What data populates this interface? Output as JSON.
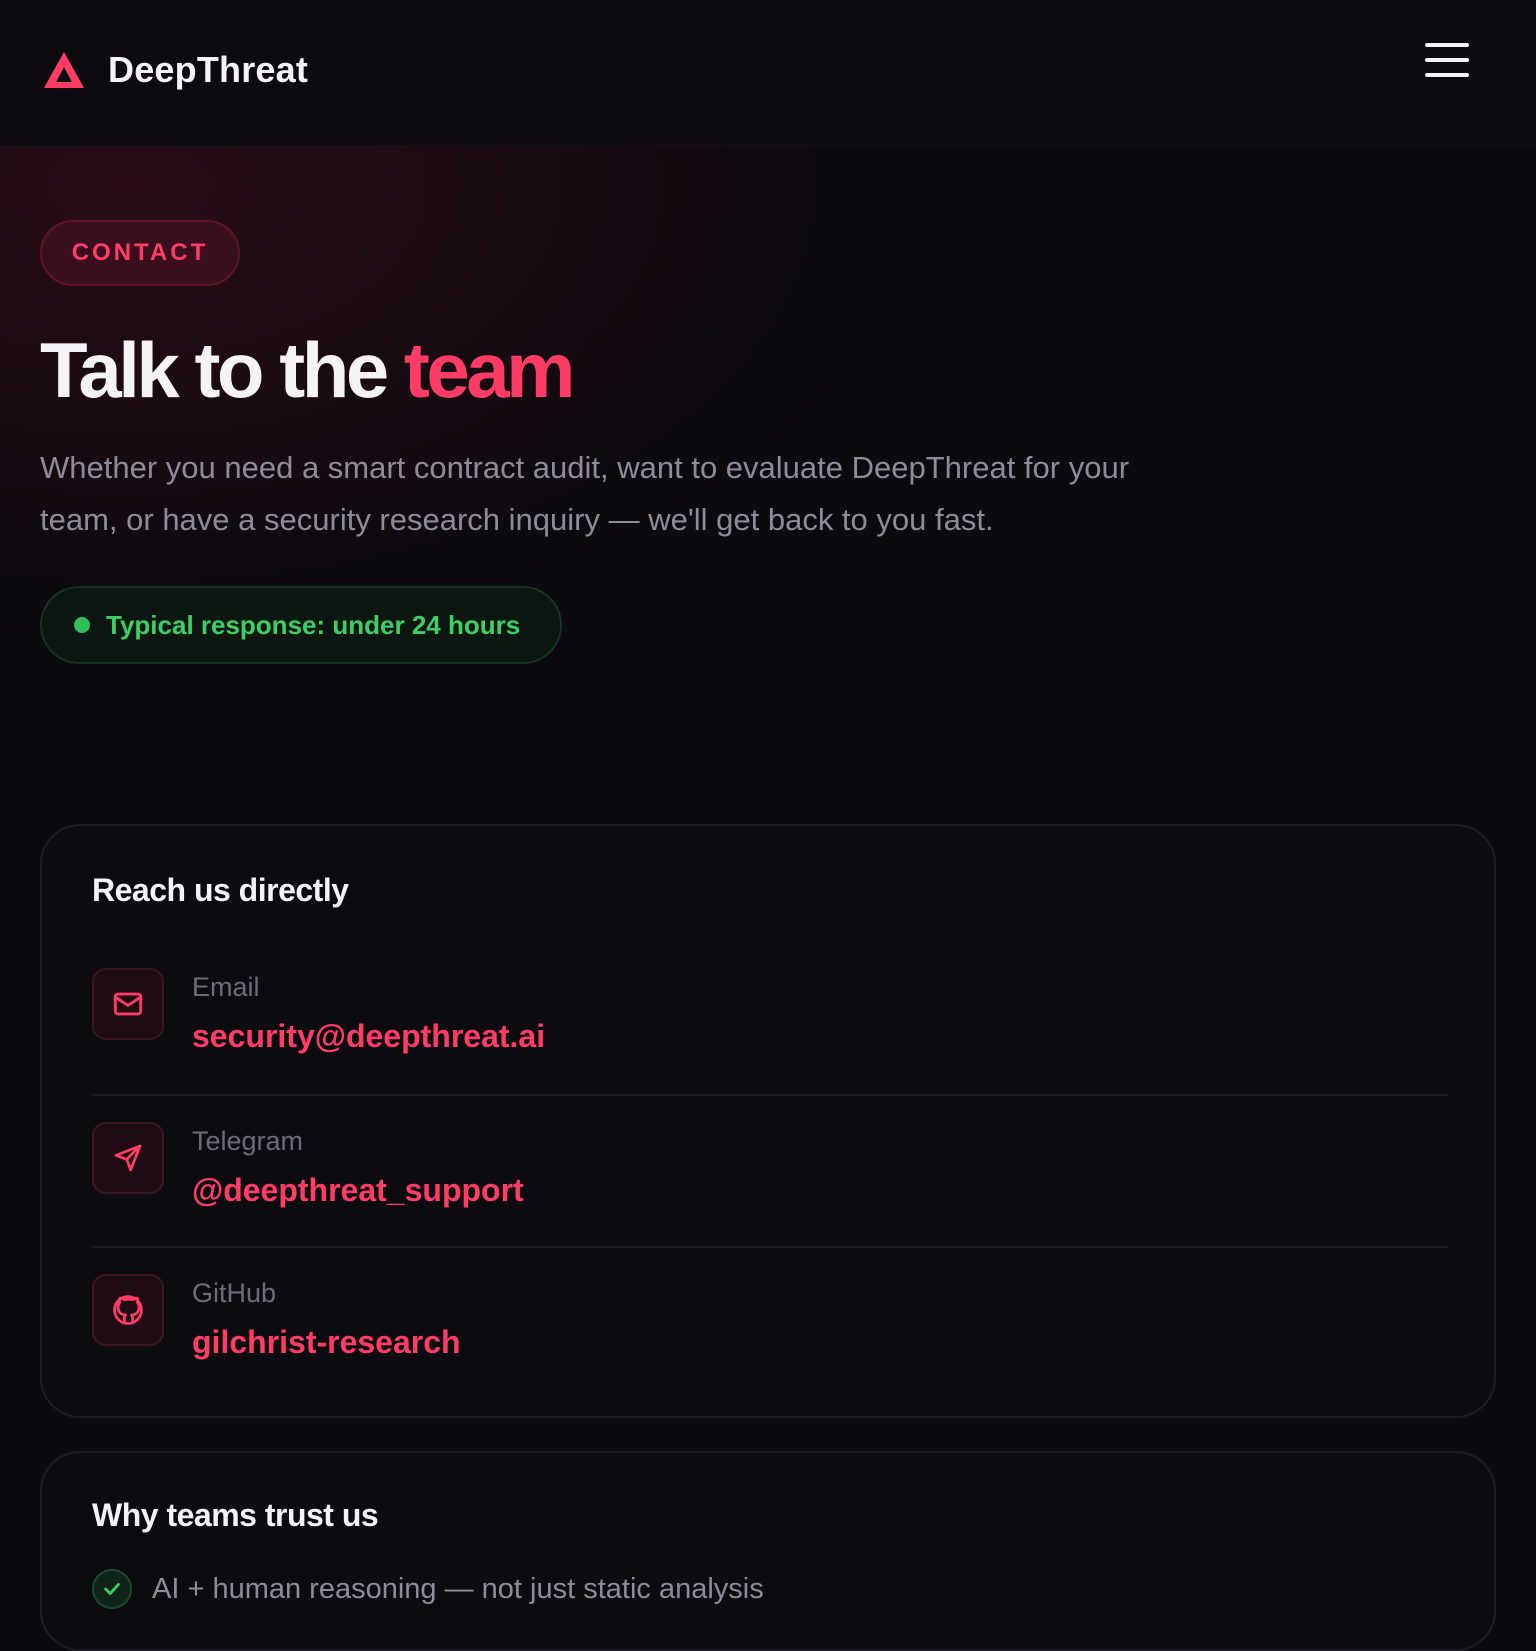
{
  "header": {
    "brand": "DeepThreat",
    "logo_icon": "triangle-logo-icon",
    "menu_icon": "hamburger-menu-icon"
  },
  "hero": {
    "tag": "CONTACT",
    "headline_main": "Talk to the",
    "headline_accent": "team",
    "subtitle": "Whether you need a smart contract audit, want to evaluate DeepThreat for your team, or have a security research inquiry — we'll get back to you fast.",
    "response_badge": "Typical response: under 24 hours"
  },
  "direct": {
    "title": "Reach us directly",
    "channels": [
      {
        "label": "Email",
        "value": "security@deepthreat.ai",
        "icon": "mail-icon"
      },
      {
        "label": "Telegram",
        "value": "@deepthreat_support",
        "icon": "send-icon"
      },
      {
        "label": "GitHub",
        "value": "gilchrist-research",
        "icon": "github-icon"
      }
    ]
  },
  "trust": {
    "title": "Why teams trust us",
    "items": [
      {
        "text": "AI + human reasoning — not just static analysis",
        "icon": "check-icon"
      }
    ]
  },
  "colors": {
    "accent": "#ff3b66",
    "success": "#3ccf64",
    "background": "#0a0a0f"
  }
}
